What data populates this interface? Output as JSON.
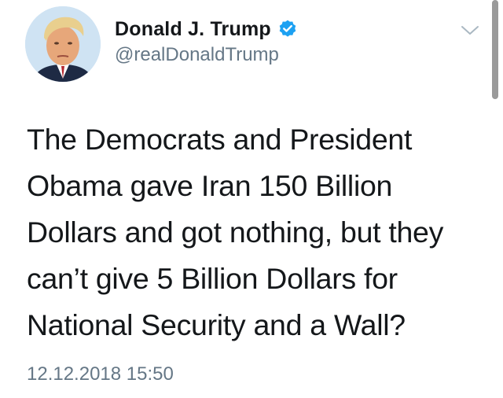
{
  "tweet": {
    "author": {
      "display_name": "Donald J. Trump",
      "handle": "@realDonaldTrump",
      "verified": true,
      "avatar_icon": "profile-photo"
    },
    "text": "The Democrats and President\nObama gave Iran 150 Billion\nDollars and got nothing, but they\ncan’t give 5 Billion Dollars for\nNational Security and a Wall?",
    "timestamp": "12.12.2018 15:50",
    "menu_icon": "chevron-down-icon"
  },
  "colors": {
    "verified_blue": "#1da1f2",
    "secondary_text": "#657786",
    "primary_text": "#14171a",
    "background": "#ffffff"
  }
}
